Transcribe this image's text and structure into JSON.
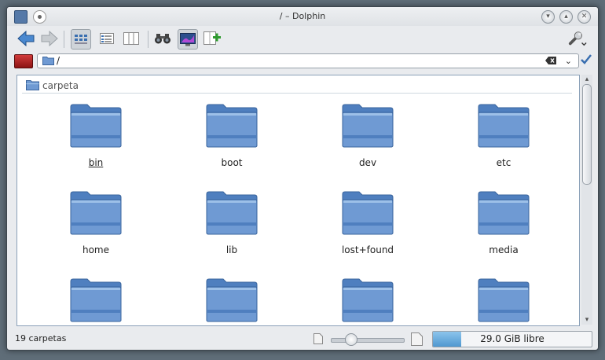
{
  "window": {
    "title": "/ – Dolphin"
  },
  "location": {
    "path": "/"
  },
  "group": {
    "title": "carpeta"
  },
  "items": [
    {
      "label": "bin"
    },
    {
      "label": "boot"
    },
    {
      "label": "dev"
    },
    {
      "label": "etc"
    },
    {
      "label": "home"
    },
    {
      "label": "lib"
    },
    {
      "label": "lost+found"
    },
    {
      "label": "media"
    }
  ],
  "status": {
    "text": "19 carpetas",
    "free_space": "29.0 GiB libre",
    "used_fraction": 0.18,
    "zoom_fraction": 0.2
  },
  "colors": {
    "folder": "#6f9ad3",
    "accent": "#4f98d0"
  }
}
